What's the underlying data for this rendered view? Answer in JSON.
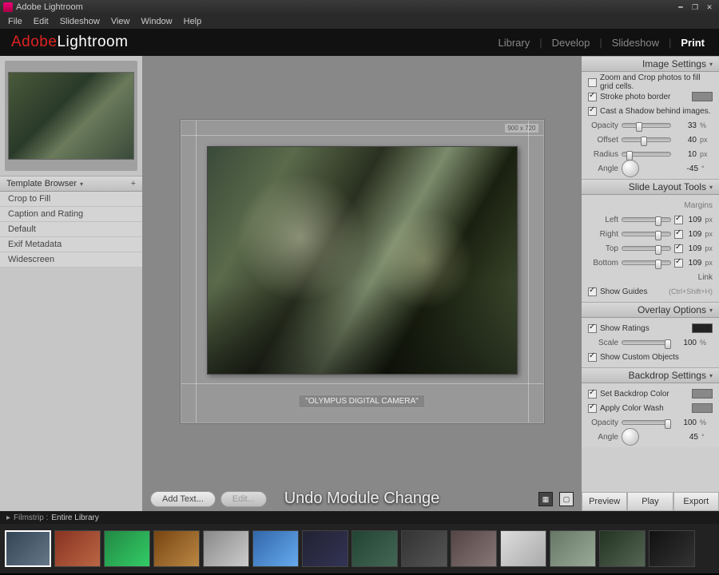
{
  "window": {
    "title": "Adobe Lightroom"
  },
  "menus": [
    "File",
    "Edit",
    "Slideshow",
    "View",
    "Window",
    "Help"
  ],
  "brand": {
    "part1": "Adobe",
    "part2": "Lightroom"
  },
  "modules": {
    "items": [
      "Library",
      "Develop",
      "Slideshow",
      "Print"
    ],
    "active": "Print"
  },
  "left": {
    "template_browser": {
      "title": "Template Browser",
      "items": [
        "Crop to Fill",
        "Caption and Rating",
        "Default",
        "Exif Metadata",
        "Widescreen"
      ]
    }
  },
  "canvas": {
    "dim_tag": "900 x 720",
    "caption": "\"OLYMPUS DIGITAL CAMERA\"",
    "toolbar": {
      "add_text": "Add Text...",
      "edit": "Edit..."
    }
  },
  "toast": "Undo Module Change",
  "right": {
    "image_settings": {
      "title": "Image Settings",
      "zoom_crop": "Zoom and Crop photos to fill grid cells.",
      "stroke": "Stroke photo border",
      "shadow": "Cast a Shadow behind images.",
      "opacity_l": "Opacity",
      "opacity_v": "33",
      "opacity_u": "%",
      "offset_l": "Offset",
      "offset_v": "40",
      "offset_u": "px",
      "radius_l": "Radius",
      "radius_v": "10",
      "radius_u": "px",
      "angle_l": "Angle",
      "angle_v": "-45",
      "angle_u": "°"
    },
    "slide_layout": {
      "title": "Slide Layout Tools",
      "margins_l": "Margins",
      "left_l": "Left",
      "left_v": "109",
      "u": "px",
      "right_l": "Right",
      "right_v": "109",
      "top_l": "Top",
      "top_v": "109",
      "bottom_l": "Bottom",
      "bottom_v": "109",
      "link_l": "Link",
      "guides": "Show Guides",
      "guides_hint": "(Ctrl+Shift+H)"
    },
    "overlay": {
      "title": "Overlay Options",
      "ratings": "Show Ratings",
      "scale_l": "Scale",
      "scale_v": "100",
      "scale_u": "%",
      "custom": "Show Custom Objects"
    },
    "backdrop": {
      "title": "Backdrop Settings",
      "color": "Set Backdrop Color",
      "wash": "Apply Color Wash",
      "opacity_l": "Opacity",
      "opacity_v": "100",
      "opacity_u": "%",
      "angle_l": "Angle",
      "angle_v": "45",
      "angle_u": "°"
    }
  },
  "bottom_buttons": [
    "Preview",
    "Play",
    "Export"
  ],
  "filmstrip_header": {
    "arrow": "▸",
    "label": "Filmstrip :",
    "scope": "Entire Library"
  },
  "film_count": 14
}
